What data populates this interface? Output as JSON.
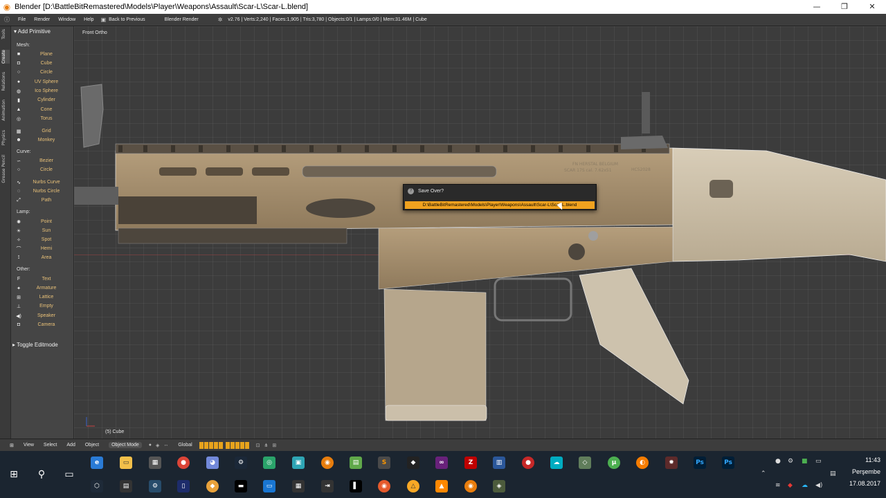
{
  "window": {
    "title": "Blender [D:\\BattleBitRemastered\\Models\\Player\\Weapons\\Assault\\Scar-L\\Scar-L.blend]",
    "minimize": "—",
    "maximize": "❐",
    "close": "✕"
  },
  "infobar": {
    "menus": [
      "File",
      "Render",
      "Window",
      "Help"
    ],
    "back": "Back to Previous",
    "engine": "Blender Render",
    "stats": "v2.76 | Verts:2,240 | Faces:1,905 | Tris:3,780 | Objects:0/1 | Lamps:0/0 | Mem:31.46M | Cube"
  },
  "tabs": [
    "Tools",
    "Create",
    "Relations",
    "Animation",
    "Physics",
    "Grease Pencil"
  ],
  "shelf": {
    "header": "Add Primitive",
    "mesh_label": "Mesh:",
    "mesh": [
      "Plane",
      "Cube",
      "Circle",
      "UV Sphere",
      "Ico Sphere",
      "Cylinder",
      "Cone",
      "Torus",
      "Grid",
      "Monkey"
    ],
    "curve_label": "Curve:",
    "curve": [
      "Bezier",
      "Circle",
      "Nurbs Curve",
      "Nurbs Circle",
      "Path"
    ],
    "lamp_label": "Lamp:",
    "lamp": [
      "Point",
      "Sun",
      "Spot",
      "Hemi",
      "Area"
    ],
    "other_label": "Other:",
    "other": [
      "Text",
      "Armature",
      "Lattice",
      "Empty",
      "Speaker",
      "Camera"
    ],
    "toggle": "Toggle Editmode"
  },
  "viewport": {
    "view_name": "Front Ortho",
    "object_label": "(5) Cube",
    "rail_marking_1": "FN HERSTAL BELGIUM",
    "rail_marking_2": "SCAR 17S cal. 7.62x51",
    "rail_marking_3": "HC52028"
  },
  "popup": {
    "title": "Save Over?",
    "path": "D:\\BattleBitRemastered\\Models\\Player\\Weapons\\Assault\\Scar-L\\Scar-L.blend"
  },
  "footer": {
    "menus": [
      "View",
      "Select",
      "Add",
      "Object"
    ],
    "mode": "Object Mode",
    "orientation": "Global"
  },
  "taskbar": {
    "time": "11:43",
    "day": "Perşembe",
    "date": "17.08.2017",
    "apps_row1": [
      "edge",
      "explorer",
      "calculator",
      "chrome",
      "discord",
      "steam",
      "browser",
      "app",
      "blender",
      "notepad",
      "sublime",
      "unity",
      "visual-studio",
      "filezilla",
      "teams",
      "record",
      "app2",
      "manager",
      "utorrent",
      "origin",
      "app3",
      "photoshop",
      "photoshop2"
    ],
    "apps_row2": [
      "unity",
      "movie",
      "steam",
      "terminal",
      "chrome",
      "cmd",
      "notes",
      "app",
      "taskview",
      "exit",
      "app",
      "origin",
      "warning",
      "vlc",
      "blender",
      "app"
    ]
  }
}
